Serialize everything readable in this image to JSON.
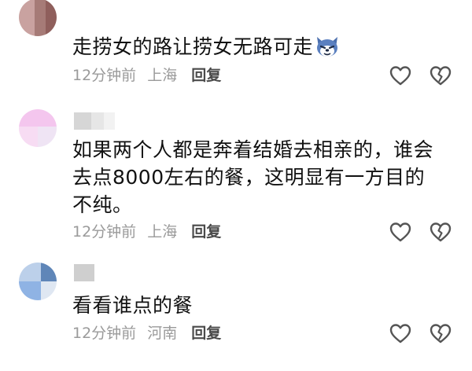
{
  "comments": [
    {
      "text": "走捞女的路让捞女无路可走",
      "emoji": "wolf-face-emoji-icon",
      "time": "12分钟前",
      "location": "上海",
      "reply_label": "回复",
      "avatar_colors": [
        "#c9a2a0",
        "#a67b77",
        "#8f5f5c"
      ]
    },
    {
      "text": "如果两个人都是奔着结婚去相亲的，谁会去点8000左右的餐，这明显有一方目的不纯。",
      "time": "12分钟前",
      "location": "上海",
      "reply_label": "回复",
      "avatar_colors": [
        "#f4c6ee",
        "#f7dcf3",
        "#efe4f4"
      ]
    },
    {
      "text": "看看谁点的餐",
      "time": "12分钟前",
      "location": "河南",
      "reply_label": "回复",
      "avatar_colors": [
        "#bcd0ea",
        "#5f86b8",
        "#8fb3e4"
      ]
    }
  ],
  "icons": {
    "like": "heart-outline-icon",
    "dislike": "broken-heart-outline-icon"
  },
  "colors": {
    "text": "#111111",
    "meta": "#9a9a9a",
    "reply": "#4a4a4a",
    "icon": "#555555"
  }
}
